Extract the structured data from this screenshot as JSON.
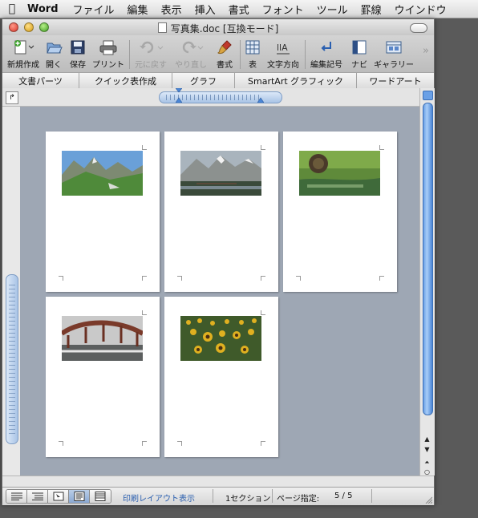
{
  "menubar": {
    "app_name": "Word",
    "items": [
      "ファイル",
      "編集",
      "表示",
      "挿入",
      "書式",
      "フォント",
      "ツール",
      "罫線",
      "ウインドウ"
    ]
  },
  "window": {
    "title": "写真集.doc [互換モード]"
  },
  "toolbar": {
    "new_label": "新規作成",
    "open_label": "開く",
    "save_label": "保存",
    "print_label": "プリント",
    "undo_label": "元に戻す",
    "redo_label": "やり直し",
    "format_label": "書式",
    "table_label": "表",
    "text_direction_label": "文字方向",
    "marks_label": "編集記号",
    "navi_label": "ナビ",
    "gallery_label": "ギャラリー"
  },
  "ribbon": {
    "tabs": [
      "文書パーツ",
      "クイック表作成",
      "グラフ",
      "SmartArt グラフィック",
      "ワードアート"
    ]
  },
  "pages": [
    {
      "photo": "mountain-valley-photo"
    },
    {
      "photo": "snowy-peaks-river-photo"
    },
    {
      "photo": "waterwheel-stream-photo"
    },
    {
      "photo": "red-arch-bridge-photo"
    },
    {
      "photo": "sunflower-field-photo"
    }
  ],
  "status": {
    "view_name": "印刷レイアウト表示",
    "section": "1セクション",
    "page_label": "ページ指定:",
    "page_value": "5 / 5"
  },
  "colors": {
    "doc_background": "#9ea7b4",
    "scroll_thumb": "#6aa0e6",
    "status_view_text": "#2a5fb0"
  }
}
